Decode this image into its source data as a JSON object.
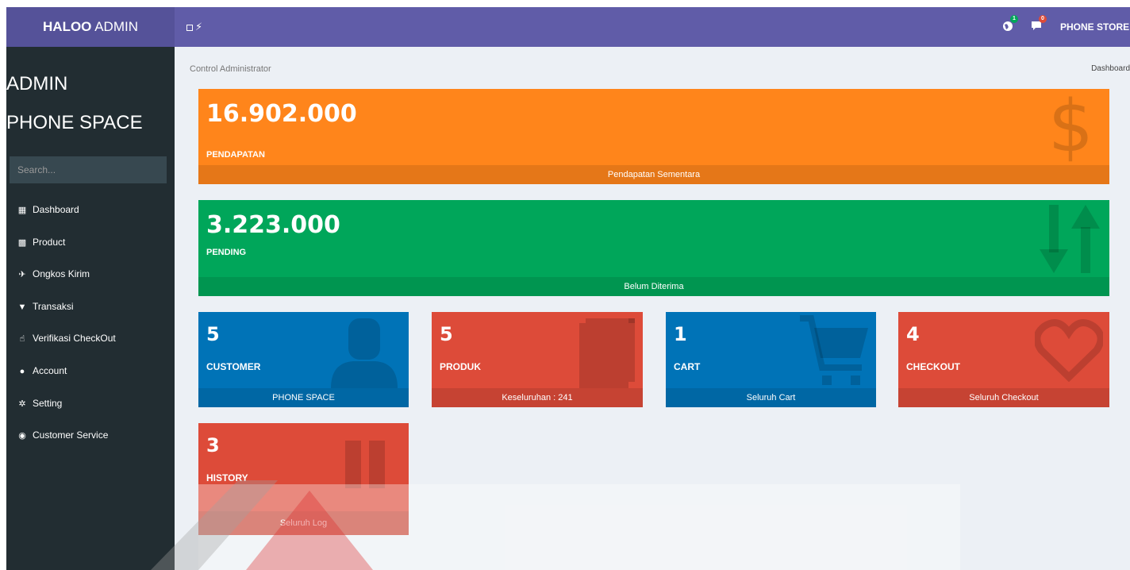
{
  "topbar": {
    "brand_bold": "HALOO",
    "brand_rest": "ADMIN",
    "toggle_glyph": "⚡",
    "globe_badge": "1",
    "chat_badge": "0",
    "user": "PHONE STORE",
    "color": "#605ca8"
  },
  "sidebar": {
    "title_line1": "ADMIN",
    "title_line2": "PHONE SPACE",
    "search_placeholder": "Search...",
    "items": [
      {
        "icon": "grid-icon",
        "label": "Dashboard"
      },
      {
        "icon": "qrcode-icon",
        "label": "Product"
      },
      {
        "icon": "plane-icon",
        "label": "Ongkos Kirim"
      },
      {
        "icon": "cart-icon",
        "label": "Transaksi"
      },
      {
        "icon": "thumbs-up-icon",
        "label": "Verifikasi CheckOut"
      },
      {
        "icon": "user-icon",
        "label": "Account"
      },
      {
        "icon": "gear-icon",
        "label": "Setting"
      },
      {
        "icon": "eye-icon",
        "label": "Customer Service"
      }
    ]
  },
  "breadcrumb": {
    "left": "Control Administrator",
    "right": "Dashboard"
  },
  "boxes": {
    "income": {
      "value": "16.902.000",
      "label": "PENDAPATAN",
      "footer": "Pendapatan Sementara",
      "color": "#ff851b"
    },
    "pending": {
      "value": "3.223.000",
      "label": "PENDING",
      "footer": "Belum Diterima",
      "color": "#00a65a"
    },
    "customer": {
      "value": "5",
      "label": "CUSTOMER",
      "footer": "PHONE SPACE",
      "color": "#0073b7"
    },
    "produk": {
      "value": "5",
      "label": "PRODUK",
      "footer": "Keseluruhan : 241",
      "color": "#dd4b39"
    },
    "cart": {
      "value": "1",
      "label": "CART",
      "footer": "Seluruh Cart",
      "color": "#0073b7"
    },
    "checkout": {
      "value": "4",
      "label": "CHECKOUT",
      "footer": "Seluruh Checkout",
      "color": "#dd4b39"
    },
    "history": {
      "value": "3",
      "label": "HISTORY",
      "footer": "Seluruh Log",
      "color": "#dd4b39"
    }
  }
}
